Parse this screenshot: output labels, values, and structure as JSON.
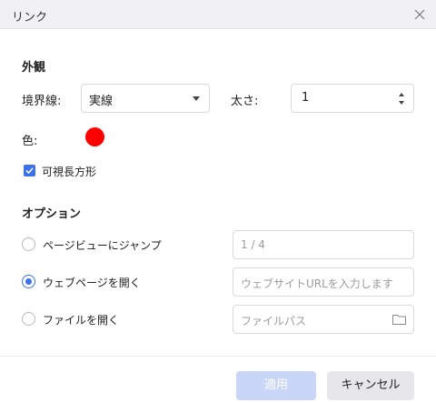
{
  "dialog": {
    "title": "リンク"
  },
  "appearance": {
    "heading": "外観",
    "border_label": "境界線:",
    "border_value": "実線",
    "thickness_label": "太さ:",
    "thickness_value": "1",
    "color_label": "色:",
    "color_value": "#ff0000",
    "visible_rect_label": "可視長方形",
    "visible_rect_checked": true
  },
  "options": {
    "heading": "オプション",
    "items": [
      {
        "label": "ページビューにジャンプ",
        "selected": false,
        "field_placeholder": "1 / 4"
      },
      {
        "label": "ウェブページを開く",
        "selected": true,
        "field_placeholder": "ウェブサイトURLを入力します"
      },
      {
        "label": "ファイルを開く",
        "selected": false,
        "field_placeholder": "ファイルパス"
      }
    ]
  },
  "buttons": {
    "apply": "適用",
    "cancel": "キャンセル"
  },
  "icons": {
    "close": "close-icon",
    "dropdown": "chevron-down-icon",
    "folder": "folder-icon",
    "check": "check-icon"
  },
  "colors": {
    "accent": "#3b71ea",
    "apply_disabled": "#c9d6f7"
  }
}
